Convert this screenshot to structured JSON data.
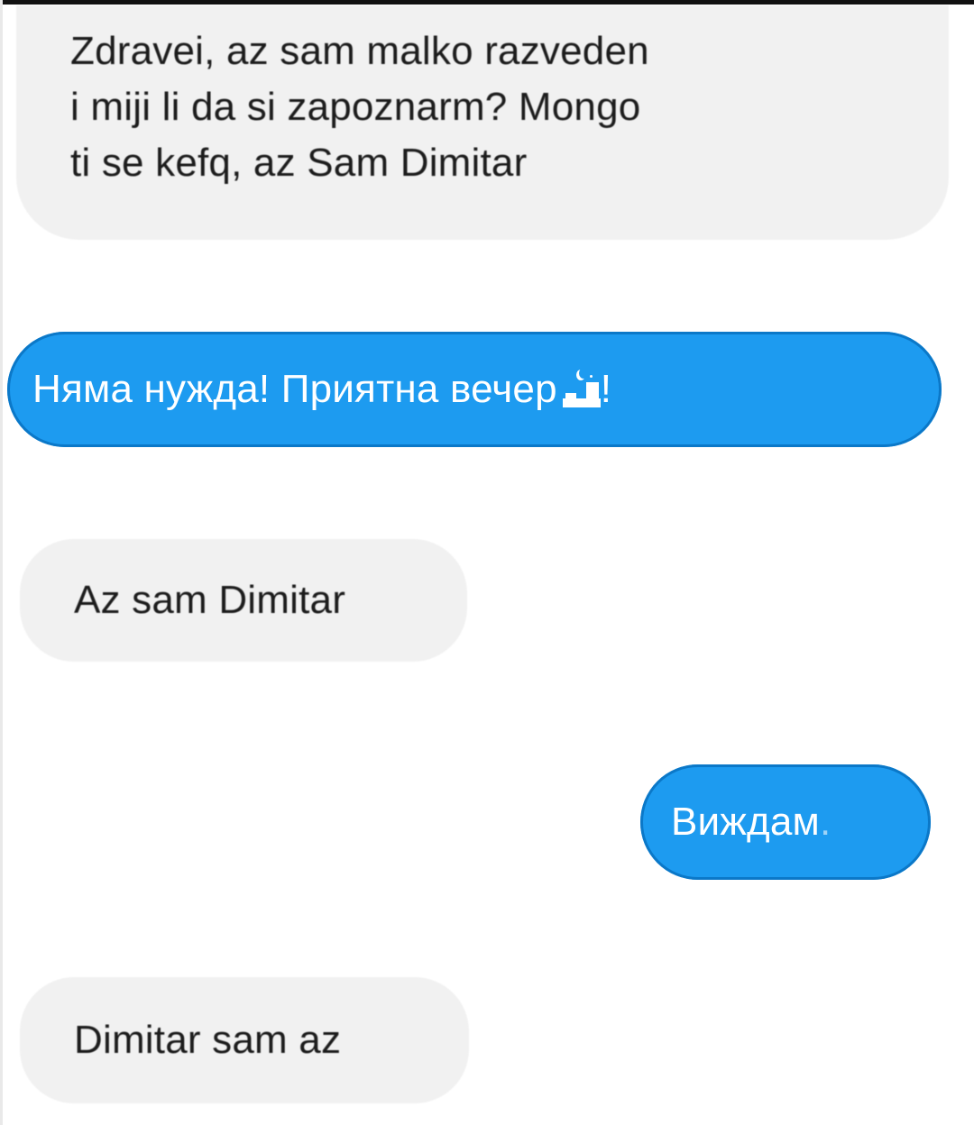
{
  "conversation": {
    "messages": [
      {
        "direction": "incoming",
        "lines": [
          "Zdravei, az sam malko razveden",
          "i miji li da si zapoznarm? Mongo",
          "ti se kefq, az Sam Dimitar"
        ]
      },
      {
        "direction": "outgoing",
        "text_before_icon": "Няма нужда! Приятна вечер",
        "icon": "night-city-icon",
        "text_after_icon": "!"
      },
      {
        "direction": "incoming",
        "text": "Az sam Dimitar"
      },
      {
        "direction": "outgoing",
        "text": "Виждам",
        "trailing": "."
      },
      {
        "direction": "incoming",
        "text": "Dimitar sam az"
      }
    ]
  },
  "colors": {
    "incoming_bubble": "#f1f1f1",
    "outgoing_bubble": "#1d9bf0",
    "outgoing_text": "#ffffff",
    "incoming_text": "#1c1c1c"
  }
}
